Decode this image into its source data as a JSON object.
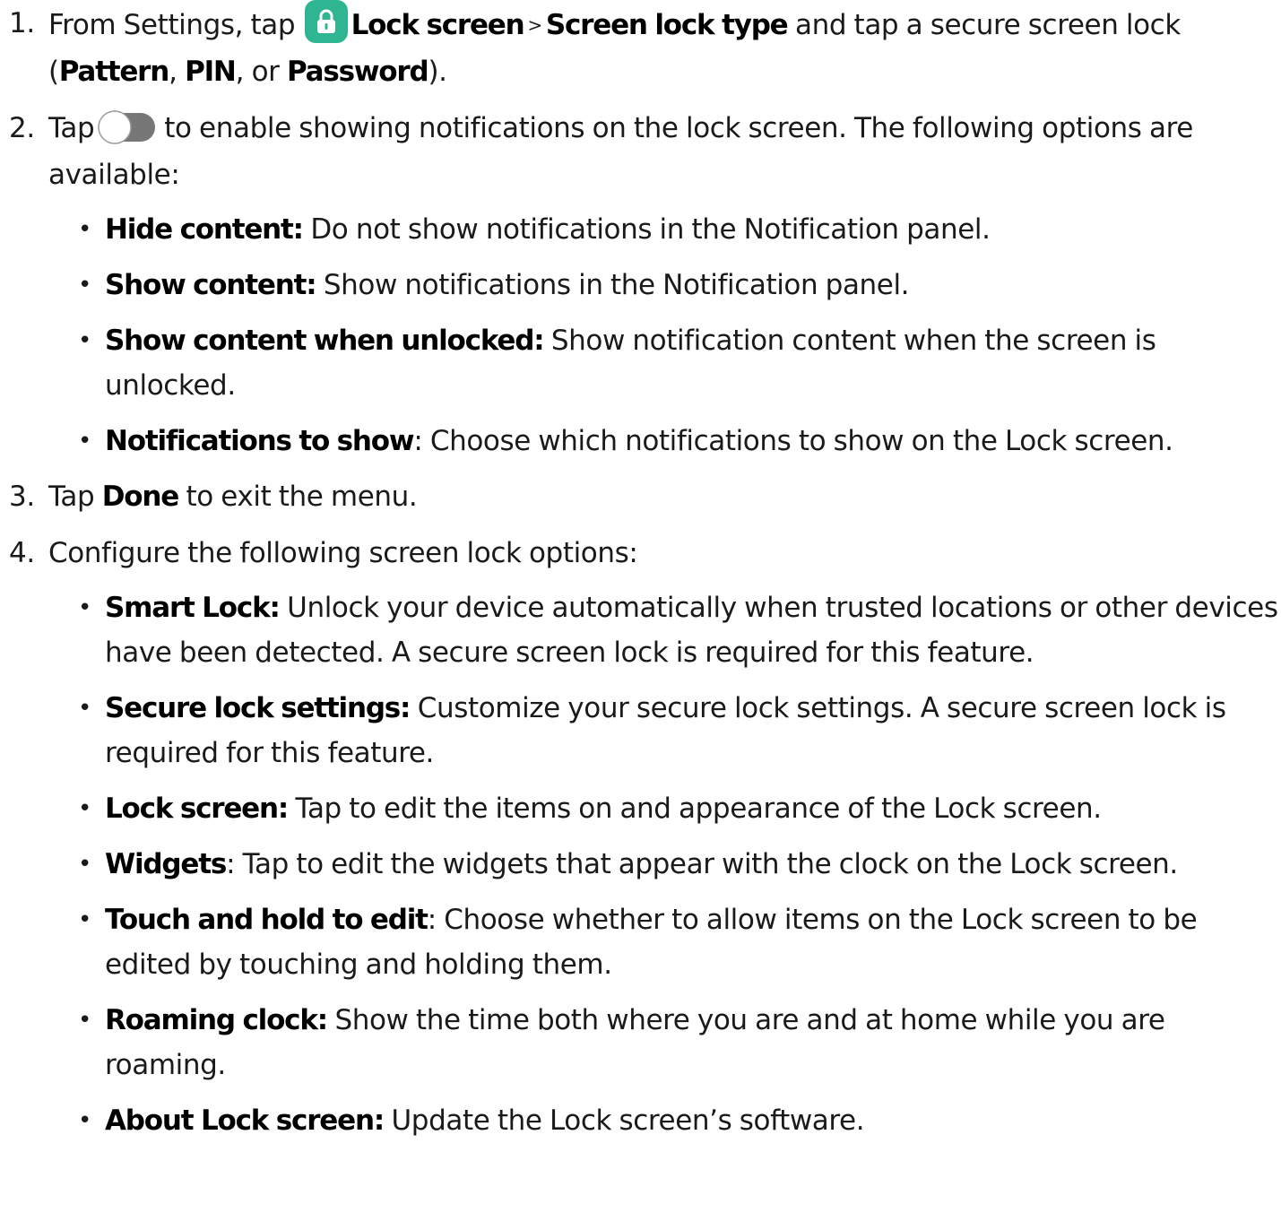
{
  "steps": [
    {
      "num": "1.",
      "t1": "From Settings, tap",
      "icon": "lock-screen-settings-icon",
      "b1": "Lock screen",
      "sep": ">",
      "b2": "Screen lock type",
      "t2": "and tap a secure screen lock (",
      "b3": "Pattern",
      "t3": ", ",
      "b4": "PIN",
      "t4": ", or ",
      "b5": "Password",
      "t5": ")."
    },
    {
      "num": "2.",
      "t1": "Tap",
      "icon": "toggle-switch-icon",
      "t2": "to enable showing notifications on the lock screen. The following options are available:",
      "bullets": [
        {
          "term": "Hide content:",
          "desc": "Do not show notifications in the Notification panel."
        },
        {
          "term": "Show content:",
          "desc": "Show notifications in the Notification panel."
        },
        {
          "term": "Show content when unlocked:",
          "desc": "Show notification content when the screen is unlocked."
        },
        {
          "term": "Notifications to show",
          "desc": ": Choose which notifications to show on the Lock screen."
        }
      ]
    },
    {
      "num": "3.",
      "t1": "Tap ",
      "b1": "Done",
      "t2": " to exit the menu."
    },
    {
      "num": "4.",
      "t1": "Configure the following screen lock options:",
      "bullets": [
        {
          "term": "Smart Lock:",
          "desc": "Unlock your device automatically when trusted locations or other devices have been detected. A secure screen lock is required for this feature."
        },
        {
          "term": "Secure lock settings:",
          "desc": "Customize your secure lock settings. A secure screen lock is required for this feature."
        },
        {
          "term": "Lock screen:",
          "desc": "Tap to edit the items on and appearance of the Lock screen."
        },
        {
          "term": "Widgets",
          "desc": ": Tap to edit the widgets that appear with the clock on the Lock screen."
        },
        {
          "term": "Touch and hold to edit",
          "desc": ": Choose whether to allow items on the Lock screen to be edited by touching and holding them."
        },
        {
          "term": "Roaming clock:",
          "desc": "Show the time both where you are and at home while you are roaming."
        },
        {
          "term": "About Lock screen:",
          "desc": "Update the Lock screen’s software."
        }
      ]
    }
  ],
  "colors": {
    "lock_icon_bg": "#2fb592",
    "toggle_knob": "#777777"
  }
}
